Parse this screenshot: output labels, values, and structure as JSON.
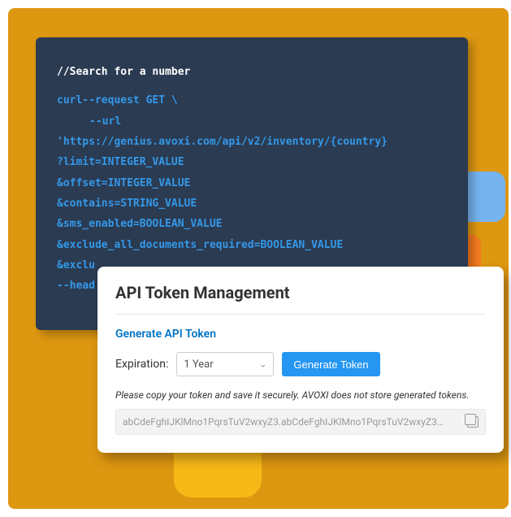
{
  "code": {
    "comment": "//Search for a number",
    "lines": [
      "curl--request GET \\",
      "--url",
      "'https://genius.avoxi.com/api/v2/inventory/{country}",
      "?limit=INTEGER_VALUE",
      "&offset=INTEGER_VALUE",
      "&contains=STRING_VALUE",
      "&sms_enabled=BOOLEAN_VALUE",
      "&exclude_all_documents_required=BOOLEAN_VALUE",
      "&exclu",
      "--head"
    ]
  },
  "token_card": {
    "title": "API Token Management",
    "generate_link": "Generate API Token",
    "expiration_label": "Expiration:",
    "expiration_value": "1 Year",
    "generate_button": "Generate Token",
    "note": "Please copy your token and save it securely. AVOXI does not store generated tokens.",
    "token_value": "abCdeFghIJKlMno1PqrsTuV2wxyZ3.abCdeFghIJKlMno1PqrsTuV2wxyZ3…"
  }
}
